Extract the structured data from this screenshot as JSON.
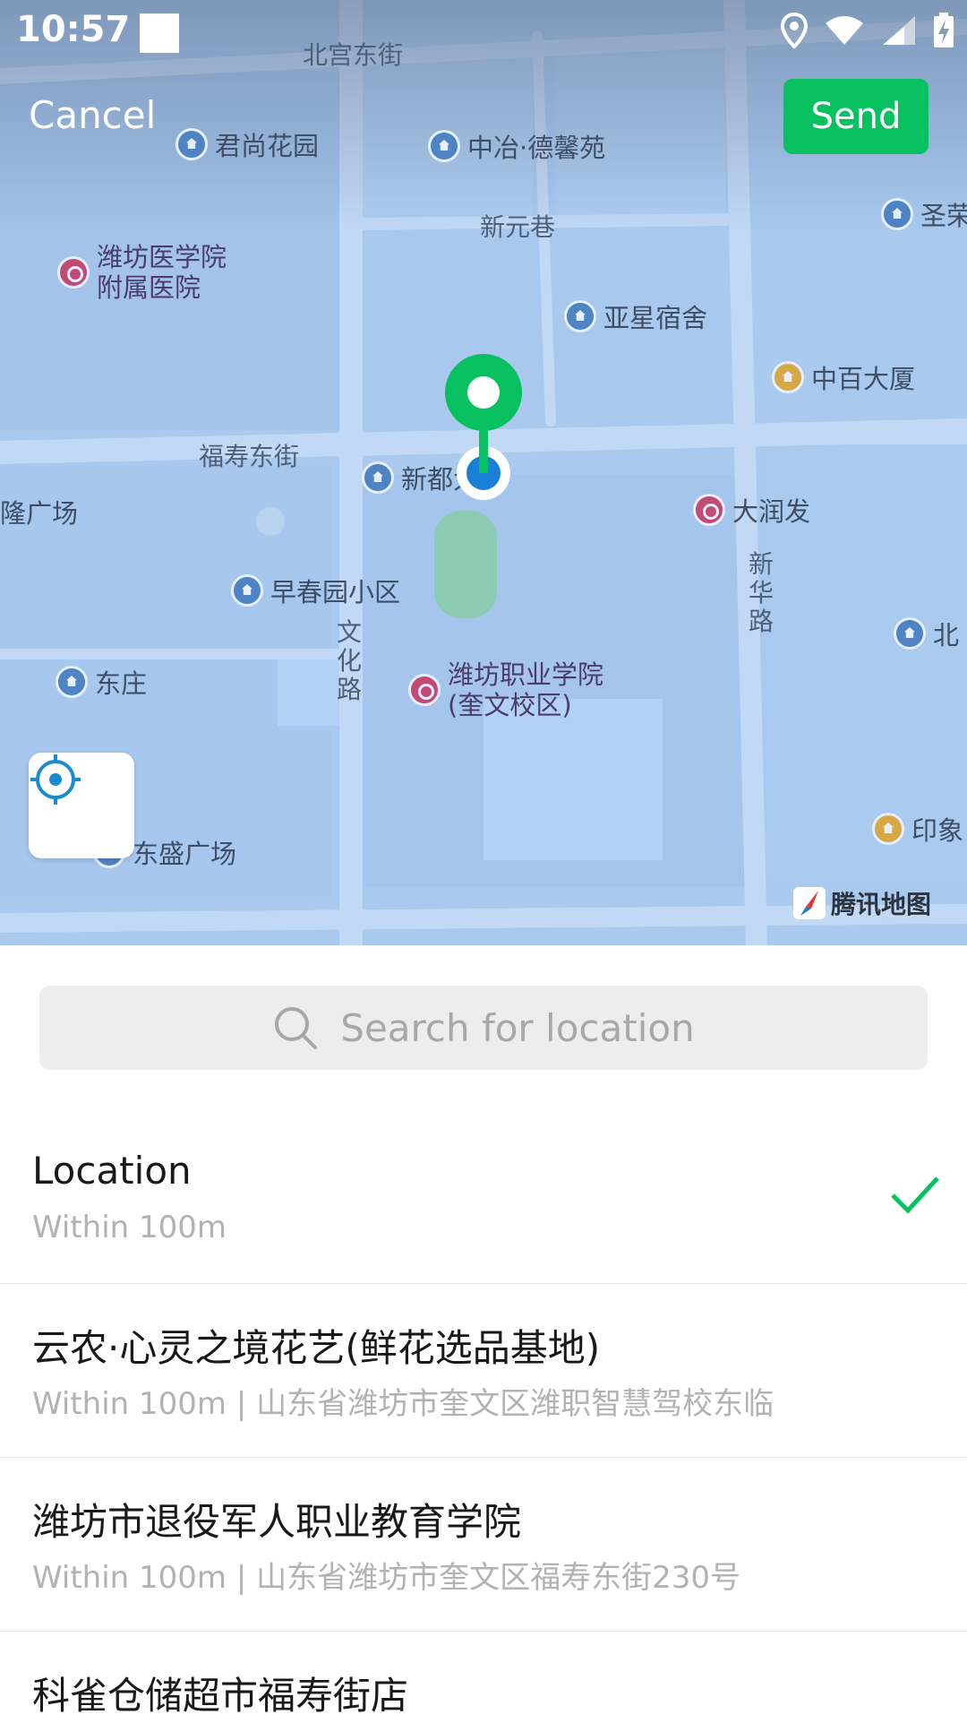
{
  "status_bar": {
    "time": "10:57"
  },
  "header": {
    "cancel_label": "Cancel",
    "send_label": "Send",
    "send_color": "#07c160"
  },
  "map": {
    "roads": {
      "beigong_dongjie": "北宫东街",
      "xinyuan_xiang": "新元巷",
      "fushou_dongjie": "福寿东街",
      "wenhua_lu": "文化路",
      "xinhua_lu": "新华路"
    },
    "pois": {
      "junshang": "君尚花园",
      "zhongye": "中冶·德馨苑",
      "sheng": "圣荣",
      "hospital_1": "潍坊医学院",
      "hospital_2": "附属医院",
      "yaxing": "亚星宿舍",
      "zhongbai": "中百大厦",
      "xindu": "新都大厦",
      "long": "隆广场",
      "runfa": "大润发",
      "zaochun": "早春园小区",
      "bei": "北",
      "dongzhuang": "东庄",
      "college_1": "潍坊职业学院",
      "college_2": "(奎文校区)",
      "dongsheng": "东盛广场",
      "yinxiang": "印象"
    },
    "watermark": "腾讯地图"
  },
  "search": {
    "placeholder": "Search for location"
  },
  "list": [
    {
      "title": "Location",
      "subtitle": "Within 100m",
      "selected": true
    },
    {
      "title": "云农·心灵之境花艺(鲜花选品基地)",
      "subtitle": "Within 100m | 山东省潍坊市奎文区潍职智慧驾校东临"
    },
    {
      "title": "潍坊市退役军人职业教育学院",
      "subtitle": "Within 100m | 山东省潍坊市奎文区福寿东街230号"
    },
    {
      "title": "科雀仓储超市福寿街店",
      "subtitle": ""
    }
  ]
}
